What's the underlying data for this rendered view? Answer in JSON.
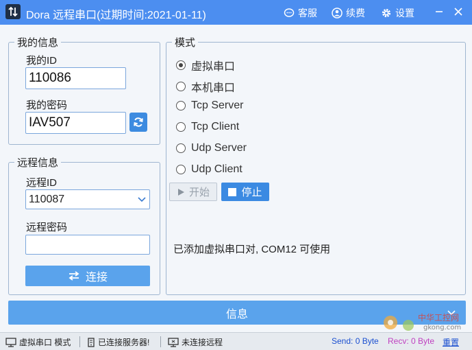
{
  "titlebar": {
    "title": "Dora 远程串口(过期时间:2021-01-11)",
    "service_label": "客服",
    "renew_label": "续费",
    "settings_label": "设置"
  },
  "my_info": {
    "legend": "我的信息",
    "id_label": "我的ID",
    "id_value": "110086",
    "password_label": "我的密码",
    "password_value": "IAV507"
  },
  "remote_info": {
    "legend": "远程信息",
    "id_label": "远程ID",
    "id_selected": "110087",
    "password_label": "远程密码",
    "password_value": "",
    "connect_label": "连接"
  },
  "mode": {
    "legend": "模式",
    "options": [
      {
        "label": "虚拟串口",
        "selected": true
      },
      {
        "label": "本机串口",
        "selected": false
      },
      {
        "label": "Tcp Server",
        "selected": false
      },
      {
        "label": "Tcp Client",
        "selected": false
      },
      {
        "label": "Udp Server",
        "selected": false
      },
      {
        "label": "Udp Client",
        "selected": false
      }
    ],
    "start_label": "开始",
    "stop_label": "停止",
    "status_message": "已添加虚拟串口对, COM12 可使用"
  },
  "info_bar": {
    "label": "信息"
  },
  "statusbar": {
    "mode_text": "虚拟串口 模式",
    "server_text": "已连接服务器!",
    "remote_text": "未连接远程",
    "send_text": "Send: 0 Byte",
    "recv_text": "Recv: 0 Byte",
    "reset_text": "重置"
  },
  "colors": {
    "accent": "#4c8ef0",
    "button": "#5aa3ec",
    "send": "#1a4fd0",
    "recv": "#c040c0",
    "reset": "#1a4fd0"
  }
}
